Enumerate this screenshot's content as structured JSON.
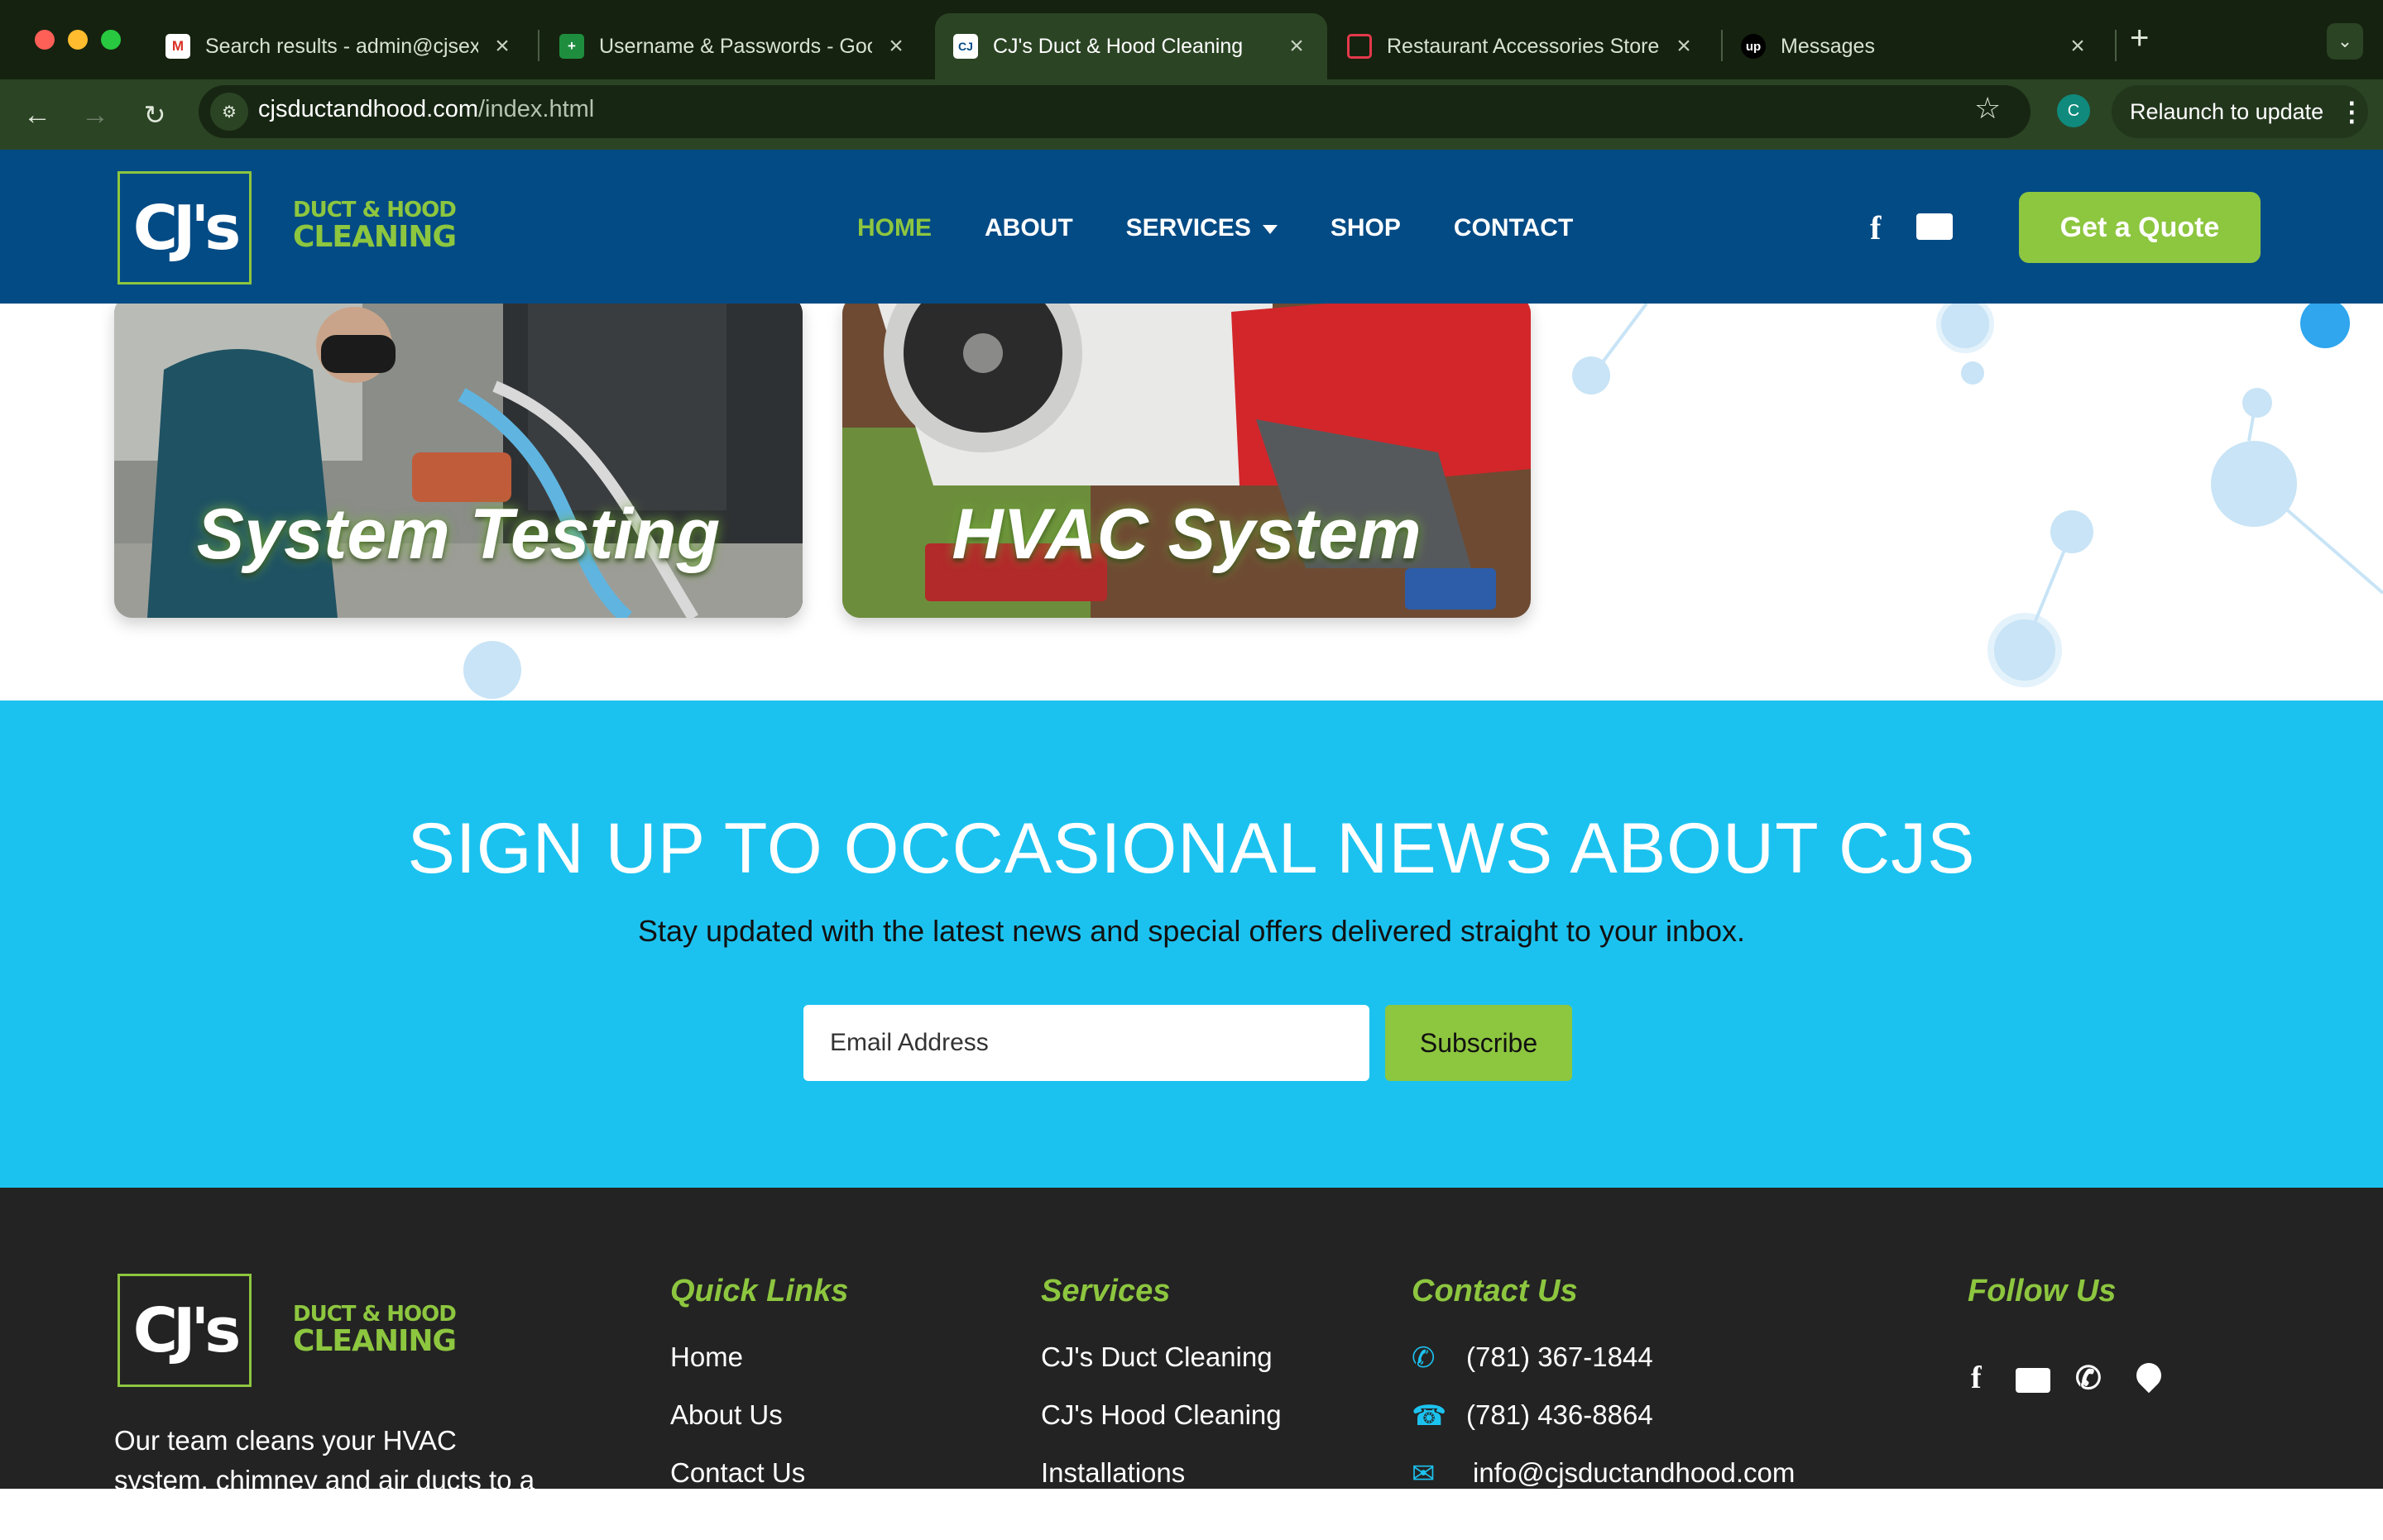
{
  "browser": {
    "tabs": [
      {
        "title": "Search results - admin@cjsex",
        "favicon": "gmail-icon"
      },
      {
        "title": "Username & Passwords - Goo",
        "favicon": "sheets-icon"
      },
      {
        "title": "CJ's Duct & Hood Cleaning",
        "favicon": "cjs-icon",
        "active": true
      },
      {
        "title": "Restaurant Accessories Store",
        "favicon": "store-icon"
      },
      {
        "title": "Messages",
        "favicon": "upwork-icon"
      }
    ],
    "url_domain": "cjsductandhood.com",
    "url_path": "/index.html",
    "profile_initial": "C",
    "relaunch_label": "Relaunch to update"
  },
  "header": {
    "logo_mark": "CJ's",
    "logo_line1": "DUCT & HOOD",
    "logo_line2": "CLEANING",
    "nav": [
      {
        "label": "HOME",
        "active": true
      },
      {
        "label": "ABOUT"
      },
      {
        "label": "SERVICES",
        "dropdown": true
      },
      {
        "label": "SHOP"
      },
      {
        "label": "CONTACT"
      }
    ],
    "quote_label": "Get a Quote",
    "brand_color": "#034b85",
    "accent_color": "#8dc63f"
  },
  "services": {
    "cards": [
      {
        "caption": "System Testing"
      },
      {
        "caption": "HVAC System"
      }
    ]
  },
  "newsletter": {
    "title": "SIGN UP TO OCCASIONAL NEWS ABOUT CJS",
    "subtitle": "Stay updated with the latest news and special offers delivered straight to your inbox.",
    "email_placeholder": "Email Address",
    "subscribe_label": "Subscribe",
    "bg_color": "#1cc2ef"
  },
  "footer": {
    "about_text": "Our team cleans your HVAC system, chimney and air ducts to a national",
    "quick_links_title": "Quick Links",
    "quick_links": [
      "Home",
      "About Us",
      "Contact Us"
    ],
    "services_title": "Services",
    "services_links": [
      "CJ's Duct Cleaning",
      "CJ's Hood Cleaning",
      "Installations"
    ],
    "contact_title": "Contact Us",
    "phone1": "(781) 367-1844",
    "phone2": "(781) 436-8864",
    "email": "info@cjsductandhood.com",
    "follow_title": "Follow Us"
  }
}
